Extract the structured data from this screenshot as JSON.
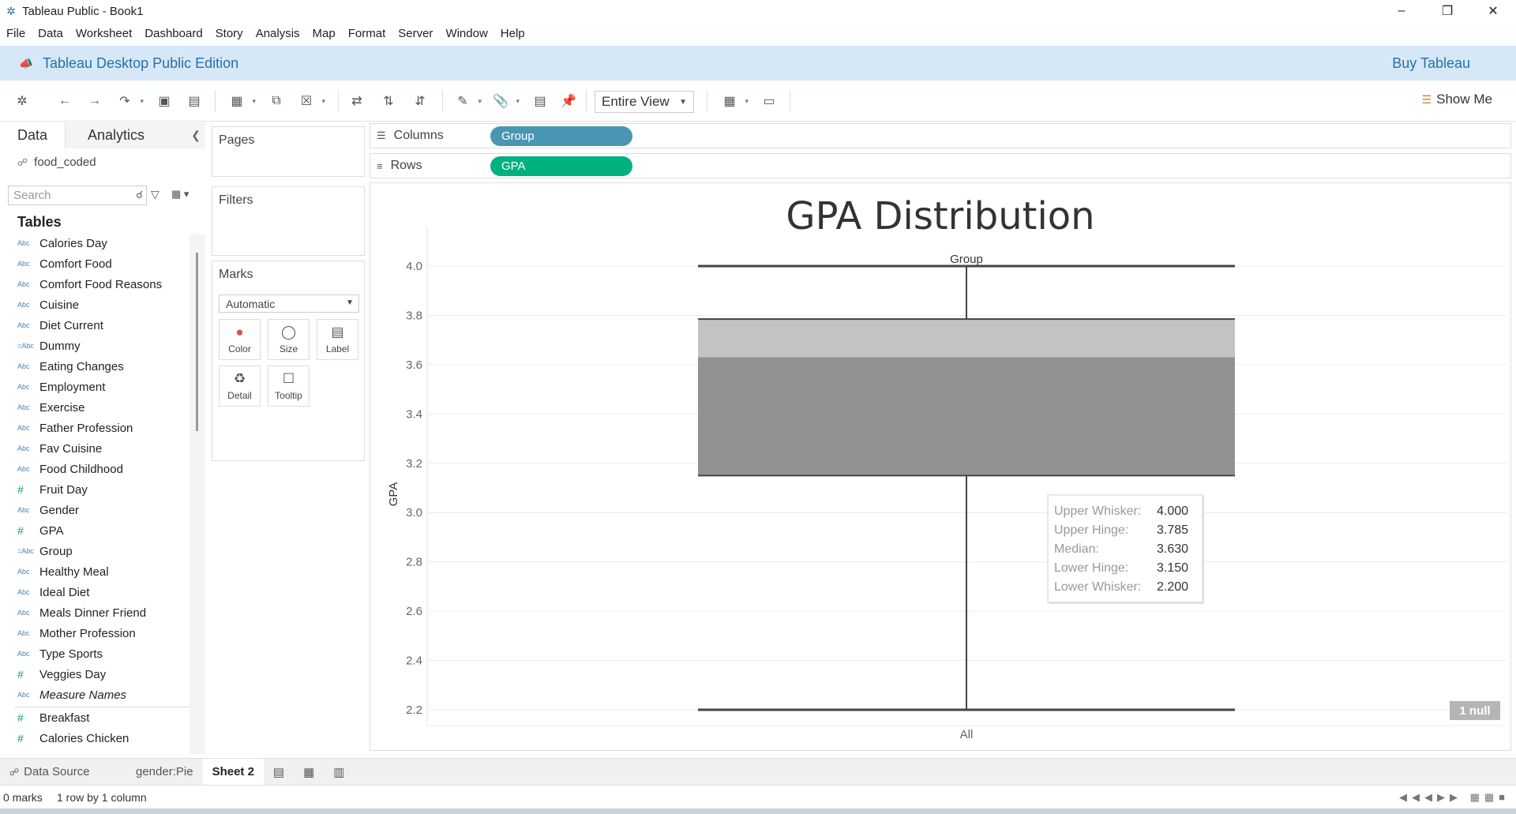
{
  "window": {
    "title": "Tableau Public - Book1",
    "app_icon": "tableau-logo-icon",
    "controls": [
      "minimize-icon",
      "restore-icon",
      "close-icon"
    ]
  },
  "menu": [
    "File",
    "Data",
    "Worksheet",
    "Dashboard",
    "Story",
    "Analysis",
    "Map",
    "Format",
    "Server",
    "Window",
    "Help"
  ],
  "banner": {
    "edition": "Tableau Desktop Public Edition",
    "buy": "Buy Tableau"
  },
  "toolbar": {
    "fit_value": "Entire View",
    "show_me": "Show Me"
  },
  "data_pane": {
    "tab_data": "Data",
    "tab_analytics": "Analytics",
    "source": "food_coded",
    "search_placeholder": "Search",
    "tables_header": "Tables",
    "fields": [
      {
        "type": "Abc",
        "name": "Calories Day"
      },
      {
        "type": "Abc",
        "name": "Comfort Food"
      },
      {
        "type": "Abc",
        "name": "Comfort Food Reasons"
      },
      {
        "type": "Abc",
        "name": "Cuisine"
      },
      {
        "type": "Abc",
        "name": "Diet Current"
      },
      {
        "type": "=Abc",
        "name": "Dummy"
      },
      {
        "type": "Abc",
        "name": "Eating Changes"
      },
      {
        "type": "Abc",
        "name": "Employment"
      },
      {
        "type": "Abc",
        "name": "Exercise"
      },
      {
        "type": "Abc",
        "name": "Father Profession"
      },
      {
        "type": "Abc",
        "name": "Fav Cuisine"
      },
      {
        "type": "Abc",
        "name": "Food Childhood"
      },
      {
        "type": "#",
        "name": "Fruit Day"
      },
      {
        "type": "Abc",
        "name": "Gender"
      },
      {
        "type": "#",
        "name": "GPA"
      },
      {
        "type": "=Abc",
        "name": "Group"
      },
      {
        "type": "Abc",
        "name": "Healthy Meal"
      },
      {
        "type": "Abc",
        "name": "Ideal Diet"
      },
      {
        "type": "Abc",
        "name": "Meals Dinner Friend"
      },
      {
        "type": "Abc",
        "name": "Mother Profession"
      },
      {
        "type": "Abc",
        "name": "Type Sports"
      },
      {
        "type": "#",
        "name": "Veggies Day"
      },
      {
        "type": "Abc",
        "name": "Measure Names"
      }
    ],
    "measures": [
      {
        "type": "#",
        "name": "Breakfast"
      },
      {
        "type": "#",
        "name": "Calories Chicken"
      }
    ]
  },
  "cards": {
    "pages": "Pages",
    "filters": "Filters",
    "marks": "Marks",
    "marks_type": "Automatic",
    "mark_buttons": [
      "Color",
      "Size",
      "Label",
      "Detail",
      "Tooltip"
    ]
  },
  "shelves": {
    "columns_label": "Columns",
    "columns_pill": "Group",
    "rows_label": "Rows",
    "rows_pill": "GPA"
  },
  "chart_data": {
    "type": "boxplot",
    "title": "GPA Distribution",
    "column_header": "Group",
    "ylabel": "GPA",
    "categories": [
      "All"
    ],
    "ylim": [
      2.2,
      4.0
    ],
    "yticks": [
      4.0,
      3.8,
      3.6,
      3.4,
      3.2,
      3.0,
      2.8,
      2.6,
      2.4,
      2.2
    ],
    "upper_whisker": 4.0,
    "upper_hinge": 3.785,
    "median": 3.63,
    "lower_hinge": 3.15,
    "lower_whisker": 2.2,
    "tooltip": [
      {
        "label": "Upper Whisker:",
        "value": "4.000"
      },
      {
        "label": "Upper Hinge:",
        "value": "3.785"
      },
      {
        "label": "Median:",
        "value": "3.630"
      },
      {
        "label": "Lower Hinge:",
        "value": "3.150"
      },
      {
        "label": "Lower Whisker:",
        "value": "2.200"
      }
    ],
    "null_badge": "1 null",
    "colors": {
      "upper_box": "#c3c3c3",
      "lower_box": "#929292",
      "whisker": "#444444"
    }
  },
  "sheet_tabs": {
    "data_source": "Data Source",
    "tabs": [
      "gender:Pie",
      "Sheet 2"
    ],
    "active": "Sheet 2"
  },
  "status": {
    "marks": "0 marks",
    "dims": "1 row by 1 column"
  }
}
